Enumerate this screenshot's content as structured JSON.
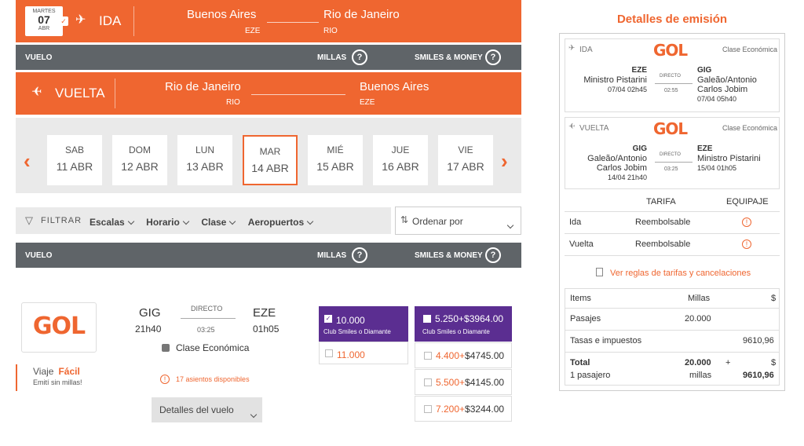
{
  "outbound": {
    "month_label": "MARTES",
    "day": "07",
    "month": "ABR",
    "direction": "IDA",
    "from_city": "Buenos Aires",
    "from_code": "EZE",
    "to_city": "Rio de Janeiro",
    "to_code": "RIO"
  },
  "header_bar_1": {
    "flight": "VUELO",
    "miles": "MILLAS",
    "smiles": "SMILES & MONEY",
    "help": "?"
  },
  "return": {
    "direction": "VUELTA",
    "from_city": "Rio de Janeiro",
    "from_code": "RIO",
    "to_city": "Buenos Aires",
    "to_code": "EZE"
  },
  "days": [
    {
      "dow": "SAB",
      "date": "11 ABR"
    },
    {
      "dow": "DOM",
      "date": "12 ABR"
    },
    {
      "dow": "LUN",
      "date": "13 ABR"
    },
    {
      "dow": "MAR",
      "date": "14 ABR"
    },
    {
      "dow": "MIÉ",
      "date": "15 ABR"
    },
    {
      "dow": "JUE",
      "date": "16 ABR"
    },
    {
      "dow": "VIE",
      "date": "17 ABR"
    }
  ],
  "filters": {
    "label": "FILTRAR",
    "items": [
      "Escalas",
      "Horario",
      "Clase",
      "Aeropuertos"
    ],
    "sort": "Ordenar por"
  },
  "header_bar_2": {
    "flight": "VUELO",
    "miles": "MILLAS",
    "smiles": "SMILES & MONEY",
    "help": "?"
  },
  "flight": {
    "airline": "GOL",
    "tagline_a": "Viaje",
    "tagline_b": "Fácil",
    "tagline_c": "Emití sin millas!",
    "from": "GIG",
    "dep": "21h40",
    "stops": "DIRECTO",
    "duration": "03:25",
    "to": "EZE",
    "arr": "01h05",
    "cabin": "Clase Económica",
    "seats": "17 asientos disponibles",
    "details_btn": "Detalles del vuelo",
    "miles_club": "10.000",
    "club_label": "Club Smiles o Diamante",
    "miles_regular": "11.000",
    "money_club_miles": "5.250+",
    "money_club_cash": "$3964.00",
    "money_options": [
      {
        "miles": "4.400+",
        "cash": "$4745.00"
      },
      {
        "miles": "5.500+",
        "cash": "$4145.00"
      },
      {
        "miles": "7.200+",
        "cash": "$3244.00"
      }
    ]
  },
  "summary": {
    "title": "Detalles de emisión",
    "ida": {
      "label": "IDA",
      "airline": "GOL",
      "cabin": "Clase Económica",
      "from_code": "EZE",
      "from_name": "Ministro Pistarini",
      "from_dt": "07/04 02h45",
      "stops": "DIRECTO",
      "duration": "02:55",
      "to_code": "GIG",
      "to_name_1": "Galeão/Antonio",
      "to_name_2": "Carlos Jobim",
      "to_dt": "07/04 05h40"
    },
    "vuelta": {
      "label": "VUELTA",
      "airline": "GOL",
      "cabin": "Clase Económica",
      "from_code": "GIG",
      "from_name_1": "Galeão/Antonio",
      "from_name_2": "Carlos Jobim",
      "from_dt": "14/04 21h40",
      "stops": "DIRECTO",
      "duration": "03:25",
      "to_code": "EZE",
      "to_name": "Ministro Pistarini",
      "to_dt": "15/04 01h05"
    },
    "fare_header": {
      "tarifa": "TARIFA",
      "equipaje": "EQUIPAJE"
    },
    "fare_rows": [
      {
        "label": "Ida",
        "fare": "Reembolsable"
      },
      {
        "label": "Vuelta",
        "fare": "Reembolsable"
      }
    ],
    "rules_link": "Ver reglas de tarifas y cancelaciones",
    "cost_header": {
      "items": "Items",
      "millas": "Millas",
      "money": "$"
    },
    "pasajes_label": "Pasajes",
    "pasajes_millas": "20.000",
    "tasas_label": "Tasas e impuestos",
    "tasas_money": "9610,96",
    "total_label": "Total",
    "total_millas": "20.000",
    "total_plus": "+",
    "total_money_sym": "$",
    "pasajero": "1 pasajero",
    "millas_word": "millas",
    "total_money": "9610,96"
  }
}
